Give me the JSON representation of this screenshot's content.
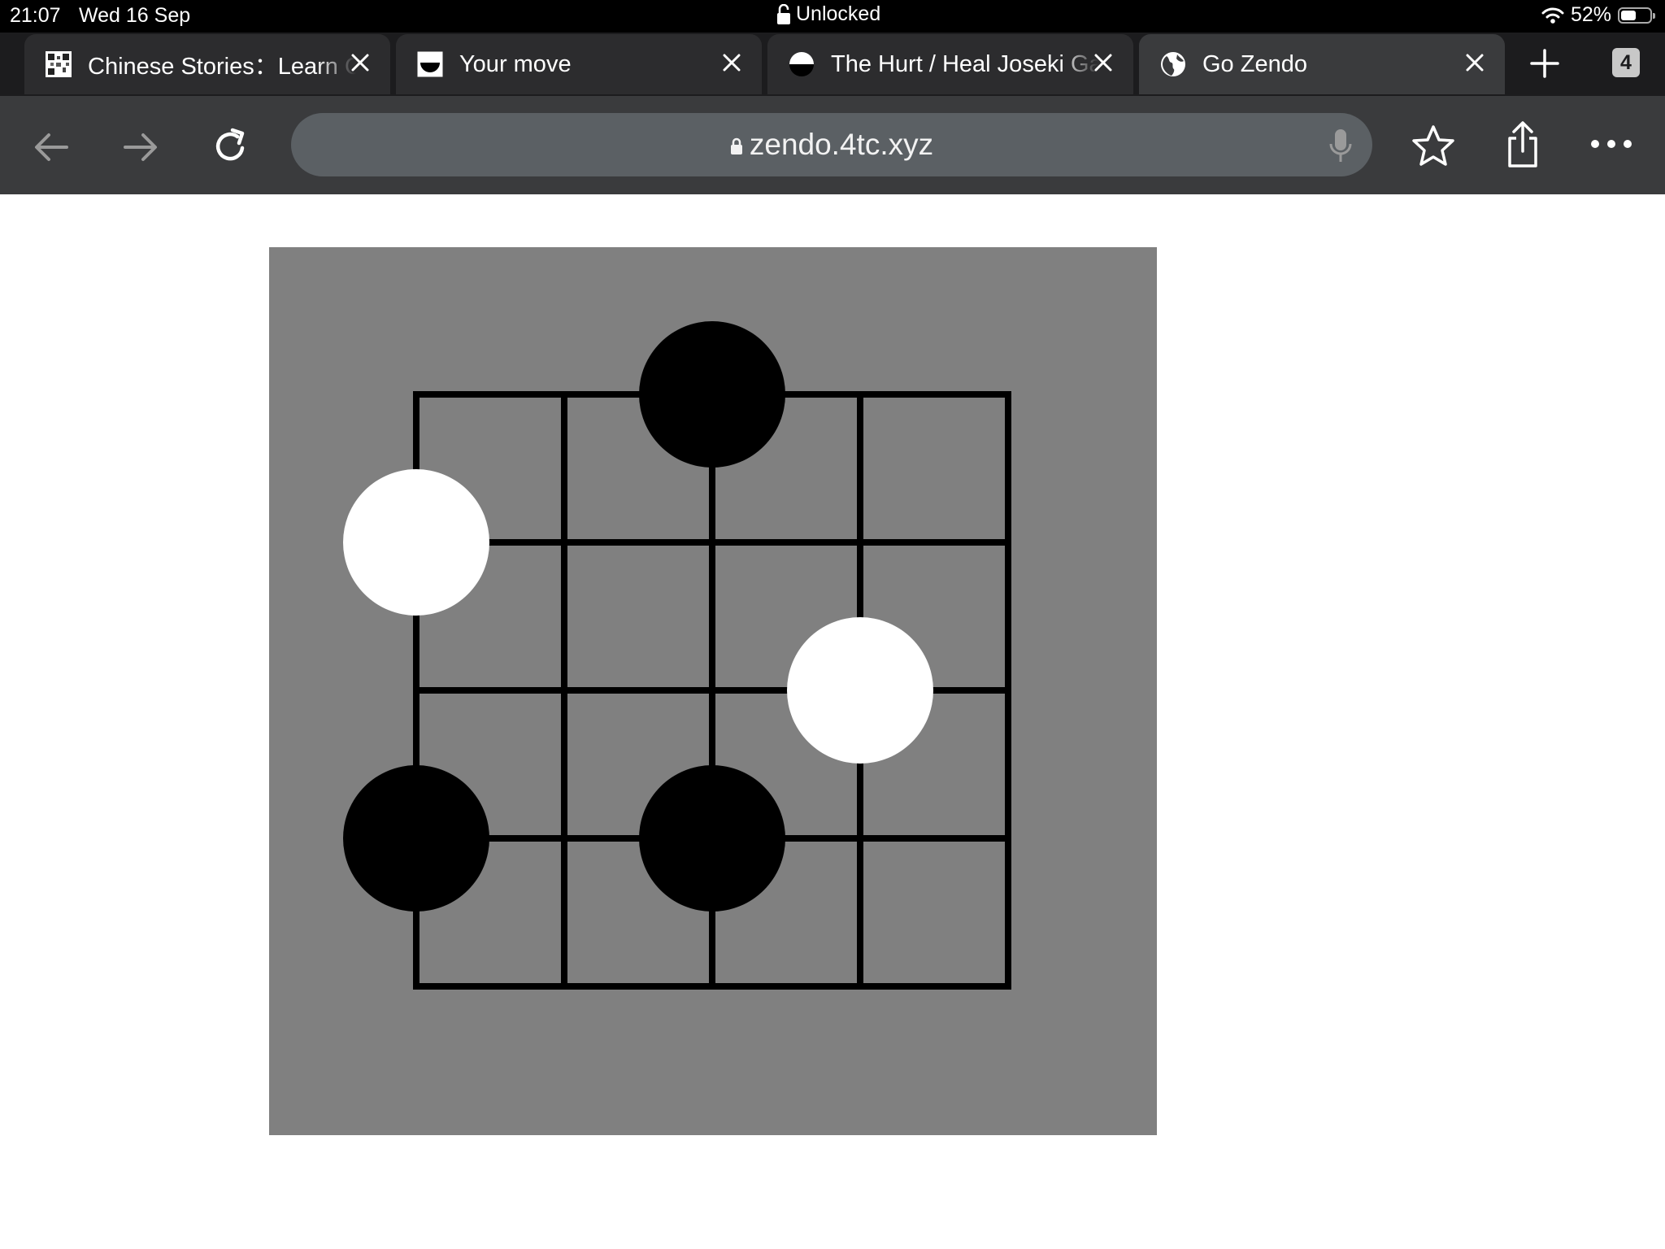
{
  "status_bar": {
    "time": "21:07",
    "date": "Wed 16 Sep",
    "lock_status": "Unlocked",
    "battery": "52%",
    "battery_level": 0.52
  },
  "tabs": [
    {
      "title": "Chinese Stories：Learn Chinese",
      "favicon": "qr-code-icon",
      "active": false
    },
    {
      "title": "Your move",
      "favicon": "half-stone-icon",
      "active": false
    },
    {
      "title": "The Hurt / Heal Joseki Game",
      "favicon": "half-stone-icon",
      "active": false
    },
    {
      "title": "Go Zendo",
      "favicon": "globe-icon",
      "active": true
    }
  ],
  "tab_count": "4",
  "toolbar": {
    "url": "zendo.4tc.xyz"
  },
  "board": {
    "size": 5,
    "background": "#808080",
    "line_color": "#000000",
    "stones": [
      {
        "color": "black",
        "col": 2,
        "row": 0
      },
      {
        "color": "white",
        "col": 0,
        "row": 1
      },
      {
        "color": "white",
        "col": 3,
        "row": 2
      },
      {
        "color": "black",
        "col": 0,
        "row": 3
      },
      {
        "color": "black",
        "col": 2,
        "row": 3
      }
    ]
  }
}
